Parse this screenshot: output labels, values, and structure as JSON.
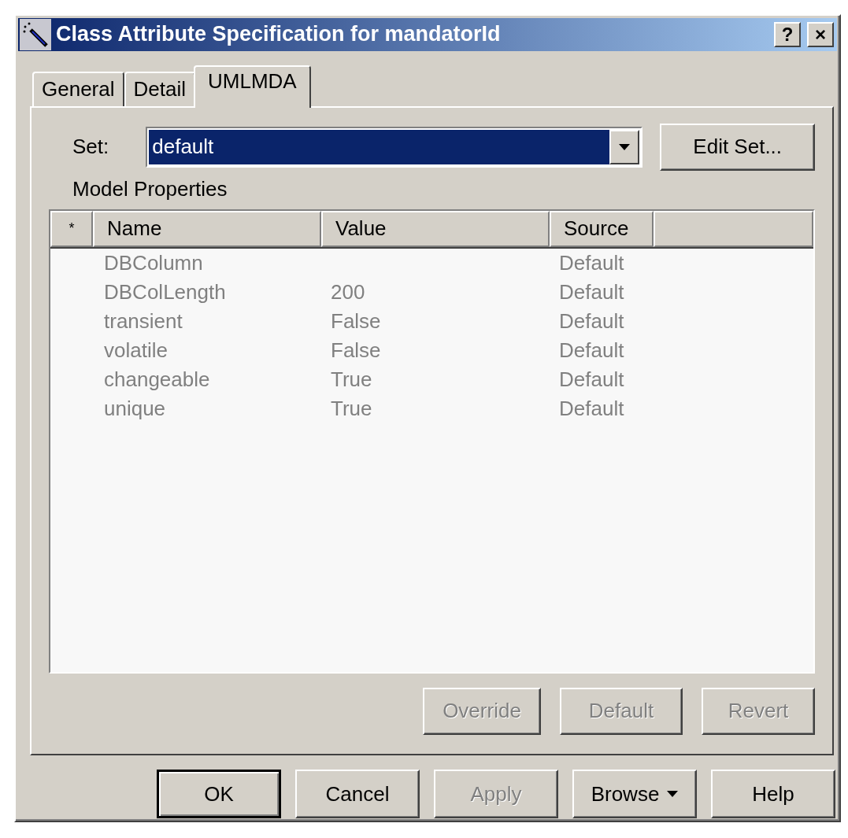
{
  "window": {
    "title": "Class Attribute Specification for mandatorId",
    "title_buttons": [
      "?",
      "×"
    ]
  },
  "tabs": [
    {
      "label": "General",
      "selected": false
    },
    {
      "label": "Detail",
      "selected": false
    },
    {
      "label": "UMLMDA",
      "selected": true
    }
  ],
  "set": {
    "label": "Set:",
    "value": "default",
    "focused": true
  },
  "edit_set_button": {
    "label": "Edit Set..."
  },
  "properties": {
    "label": "Model Properties",
    "columns": [
      "*",
      "Name",
      "Value",
      "Source"
    ],
    "rows": [
      {
        "name": "DBColumn",
        "value": "",
        "source": "Default"
      },
      {
        "name": "DBColLength",
        "value": "200",
        "source": "Default"
      },
      {
        "name": "transient",
        "value": "False",
        "source": "Default"
      },
      {
        "name": "volatile",
        "value": "False",
        "source": "Default"
      },
      {
        "name": "changeable",
        "value": "True",
        "source": "Default"
      },
      {
        "name": "unique",
        "value": "True",
        "source": "Default"
      }
    ]
  },
  "property_buttons": [
    {
      "label": "Override",
      "disabled": true
    },
    {
      "label": "Default",
      "disabled": true
    },
    {
      "label": "Revert",
      "disabled": true
    }
  ],
  "dialog_buttons": [
    {
      "label": "OK",
      "disabled": false,
      "default": true,
      "kind": "plain"
    },
    {
      "label": "Cancel",
      "disabled": false,
      "default": false,
      "kind": "plain"
    },
    {
      "label": "Apply",
      "disabled": true,
      "default": false,
      "kind": "plain"
    },
    {
      "label": "Browse",
      "disabled": false,
      "default": false,
      "kind": "menu"
    },
    {
      "label": "Help",
      "disabled": false,
      "default": false,
      "kind": "plain"
    }
  ]
}
